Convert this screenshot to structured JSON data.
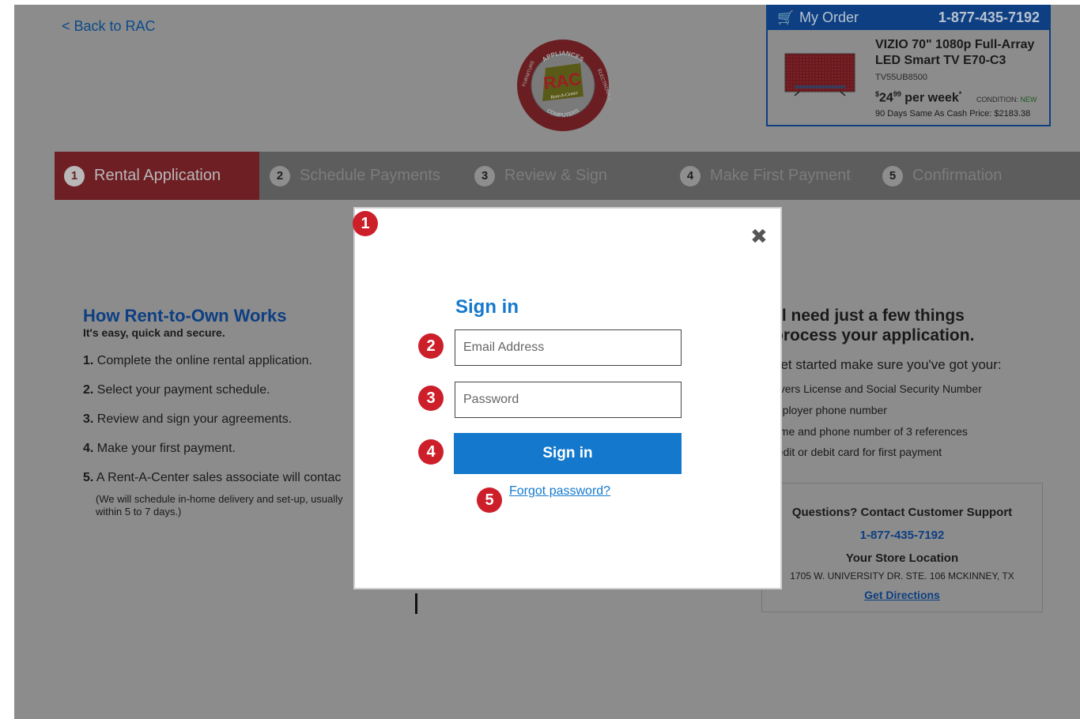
{
  "header": {
    "back_link": "< Back to RAC",
    "logo": {
      "ring_top": "APPLIANCES",
      "ring_left": "FURNITURE",
      "ring_right": "ELECTRONICS",
      "ring_bottom": "COMPUTERS",
      "monogram": "RAC",
      "script": "Rent-A-Center"
    }
  },
  "order": {
    "label": "My Order",
    "phone": "1-877-435-7192",
    "product_name": "VIZIO 70\" 1080p Full-Array LED Smart TV E70-C3",
    "sku": "TV55UB8500",
    "price_dollar": "$",
    "price_whole": "24",
    "price_cents": "99",
    "price_suffix": " per week",
    "price_asterisk": "*",
    "condition_label": "CONDITION: ",
    "condition_value": "NEW",
    "cash_price": "90 Days Same As Cash Price: $2183.38"
  },
  "steps": [
    {
      "num": "1",
      "label": "Rental Application",
      "active": true
    },
    {
      "num": "2",
      "label": "Schedule Payments",
      "active": false
    },
    {
      "num": "3",
      "label": "Review & Sign",
      "active": false
    },
    {
      "num": "4",
      "label": "Make First Payment",
      "active": false
    },
    {
      "num": "5",
      "label": "Confirmation",
      "active": false
    }
  ],
  "how": {
    "title": "How Rent-to-Own Works",
    "subtitle": "It's easy, quick and secure.",
    "items": [
      {
        "num": "1.",
        "text": " Complete the online rental application."
      },
      {
        "num": "2.",
        "text": " Select your payment schedule."
      },
      {
        "num": "3.",
        "text": " Review and sign your agreements."
      },
      {
        "num": "4.",
        "text": " Make your first payment."
      },
      {
        "num": "5.",
        "text": " A Rent-A-Center sales associate will contac"
      }
    ],
    "note": "(We will schedule in-home delivery and set-up, usually within 5 to 7 days.)"
  },
  "needs": {
    "heading_line1": "'ll need just a few things",
    "heading_line2": "process your application.",
    "intro": "get started make sure you've got your:",
    "items": [
      "rivers License and Social Security Number",
      "mployer phone number",
      "ame and phone number of 3 references",
      "redit or debit card for first payment"
    ]
  },
  "support": {
    "question": "Questions? Contact Customer Support",
    "phone": "1-877-435-7192",
    "store_label": "Your Store Location",
    "address": "1705 W. UNIVERSITY DR. STE. 106 MCKINNEY, TX",
    "directions": "Get Directions"
  },
  "modal": {
    "close": "✖",
    "title": "Sign in",
    "email_placeholder": "Email Address",
    "password_placeholder": "Password",
    "signin_button": "Sign in",
    "forgot_link": "Forgot password? "
  },
  "badges": [
    "1",
    "2",
    "3",
    "4",
    "5"
  ],
  "colors": {
    "overlay_gray": "#8c8c8c",
    "brand_blue": "#1479cc",
    "dark_blue": "#0d3f82",
    "badge_red": "#cc1f2a",
    "active_step": "#6e1f24"
  }
}
